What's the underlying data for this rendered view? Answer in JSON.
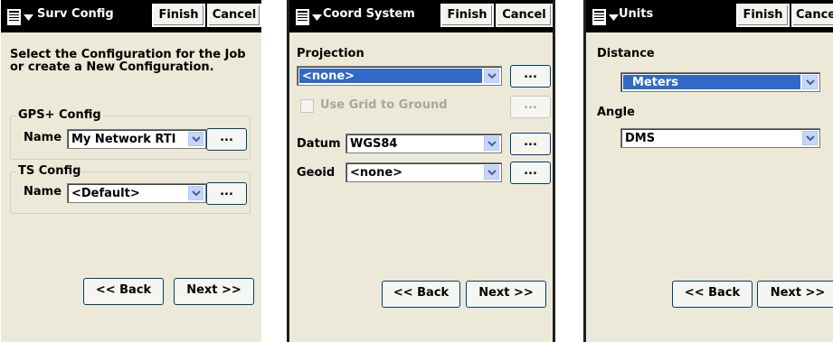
{
  "screens": [
    {
      "title": "Surv Config",
      "finish_label": "Finish",
      "cancel_label": "Cancel",
      "instructions": "Select the Configuration for the Job or create a New Configuration.",
      "gps_group": {
        "label": "GPS+ Config",
        "name_label": "Name",
        "value": "My Network RTI",
        "more_label": "..."
      },
      "ts_group": {
        "label": "TS Config",
        "name_label": "Name",
        "value": "<Default>",
        "more_label": "..."
      },
      "back_label": "<< Back",
      "next_label": "Next >>"
    },
    {
      "title": "Coord System",
      "finish_label": "Finish",
      "cancel_label": "Cancel",
      "projection_label": "Projection",
      "projection_value": "<none>",
      "projection_more": "...",
      "grid_label": "Use Grid to Ground",
      "grid_more": "...",
      "datum_label": "Datum",
      "datum_value": "WGS84",
      "datum_more": "...",
      "geoid_label": "Geoid",
      "geoid_value": "<none>",
      "geoid_more": "...",
      "back_label": "<< Back",
      "next_label": "Next >>"
    },
    {
      "title": "Units",
      "finish_label": "Finish",
      "cancel_label": "Cance",
      "distance_label": "Distance",
      "distance_value": "Meters",
      "angle_label": "Angle",
      "angle_value": "DMS",
      "back_label": "<< Back",
      "next_label": "Next >>"
    }
  ],
  "colors": {
    "titlebar": "#000000",
    "panel": "#ece9d8",
    "selection": "#3169c6",
    "dropdown_arrow": "#c5d5fc"
  },
  "icons": {
    "menu": "menu-icon",
    "dropdown": "chevron-down-icon"
  }
}
